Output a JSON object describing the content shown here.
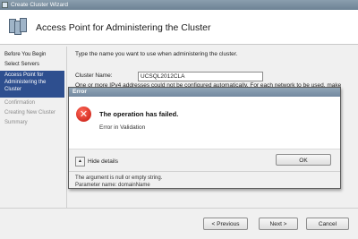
{
  "window": {
    "title": "Create Cluster Wizard"
  },
  "header": {
    "title": "Access Point for Administering the Cluster"
  },
  "nav": {
    "items": [
      {
        "label": "Before You Begin",
        "state": "normal"
      },
      {
        "label": "Select Servers",
        "state": "normal"
      },
      {
        "label": "Access Point for Administering the Cluster",
        "state": "active"
      },
      {
        "label": "Confirmation",
        "state": "disabled"
      },
      {
        "label": "Creating New Cluster",
        "state": "disabled"
      },
      {
        "label": "Summary",
        "state": "disabled"
      }
    ]
  },
  "content": {
    "instruction": "Type the name you want to use when administering the cluster.",
    "cluster_name_label": "Cluster Name:",
    "cluster_name_value": "UCSQL2012CLA",
    "warning": "One or more IPv4 addresses could not be configured automatically. For each network to be used, make"
  },
  "buttons": {
    "previous": "< Previous",
    "next": "Next >",
    "cancel": "Cancel"
  },
  "error_dialog": {
    "title": "Error",
    "message": "The operation has failed.",
    "sub_message": "Error in Validation",
    "hide_details": "Hide details",
    "ok": "OK",
    "details_line1": "The argument is null or empty string.",
    "details_line2": "Parameter name: domainName"
  },
  "colors": {
    "active_nav": "#2e4f8f",
    "title_bar": "#7389a0",
    "error_red": "#c3150c"
  }
}
